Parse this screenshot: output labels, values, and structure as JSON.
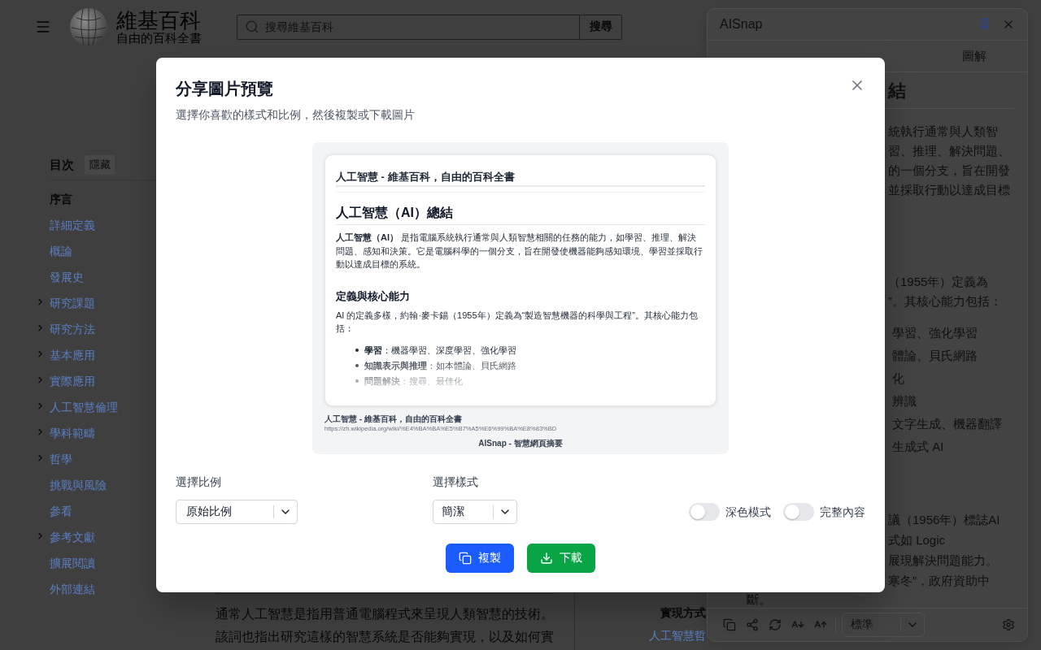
{
  "wiki": {
    "header": {
      "wordmark": "維基百科",
      "tagline": "自由的百科全書",
      "search": {
        "placeholder": "搜尋維基百科",
        "button": "搜尋"
      }
    },
    "toc": {
      "title": "目次",
      "hide_button": "隱藏",
      "items": [
        {
          "label": "序言",
          "selected": true,
          "collapsible": false
        },
        {
          "label": "詳細定義",
          "selected": false,
          "collapsible": false
        },
        {
          "label": "概論",
          "selected": false,
          "collapsible": false
        },
        {
          "label": "發展史",
          "selected": false,
          "collapsible": false
        },
        {
          "label": "研究課題",
          "selected": false,
          "collapsible": true
        },
        {
          "label": "研究方法",
          "selected": false,
          "collapsible": true
        },
        {
          "label": "基本應用",
          "selected": false,
          "collapsible": true
        },
        {
          "label": "實際應用",
          "selected": false,
          "collapsible": true
        },
        {
          "label": "人工智慧倫理",
          "selected": false,
          "collapsible": true
        },
        {
          "label": "學科範疇",
          "selected": false,
          "collapsible": true
        },
        {
          "label": "哲學",
          "selected": false,
          "collapsible": true
        },
        {
          "label": "挑戰與風險",
          "selected": false,
          "collapsible": false
        },
        {
          "label": "參看",
          "selected": false,
          "collapsible": false
        },
        {
          "label": "參考文獻",
          "selected": false,
          "collapsible": true
        },
        {
          "label": "擴展閱讀",
          "selected": false,
          "collapsible": false
        },
        {
          "label": "外部連結",
          "selected": false,
          "collapsible": false
        }
      ]
    },
    "article": {
      "lines": [
        "通常人工智慧是指用普通電腦程式來呈現人類智慧的技術。",
        "該詞也指出研究這樣的智慧系統是否能夠實現，以及如何實"
      ]
    },
    "infobox": {
      "items": [
        {
          "kind": "label",
          "text": "實現方式"
        },
        {
          "kind": "link",
          "text": "人工智慧哲"
        }
      ]
    }
  },
  "side_panel": {
    "title": "AISnap",
    "tabs": [
      {
        "label": "圖解"
      }
    ],
    "summary": {
      "heading": "結",
      "blocks": [
        {
          "kind": "text",
          "lines": [
            "統執行通常與人類智",
            "習、推理、解決問題、",
            "的一個分支，旨在開發",
            "並採取行動以達成目標"
          ]
        },
        {
          "kind": "text",
          "lines": [
            "（1955年）定義為",
            "”。其核心能力包括："
          ]
        },
        {
          "kind": "list",
          "lines": [
            "學習、強化學習",
            "體論、貝氏網路",
            "化",
            "辨識",
            "文字生成、機器翻譯",
            "生成式 AI"
          ]
        },
        {
          "kind": "text",
          "lines": [
            "議（1956年）標誌AI",
            "式如 Logic",
            "展現解決問題能力。",
            "寒冬”，政府資助中"
          ]
        }
      ],
      "tail": "斷。"
    },
    "toolbar": {
      "size_select": "標準"
    }
  },
  "share_dialog": {
    "title": "分享圖片預覽",
    "subtitle": "選擇你喜歡的樣式和比例，然後複製或下載圖片",
    "preview": {
      "page_title": "人工智慧 - 維基百科，自由的百科全書",
      "heading": "人工智慧（AI）總結",
      "intro": "**人工智慧（AI）** 是指電腦系統執行通常與人類智慧相關的任務的能力，如學習、推理、解決問題、感知和決策。它是電腦科學的一個分支，旨在開發使機器能夠感知環境、學習並採取行動以達成目標的系統。",
      "section_heading": "定義與核心能力",
      "section_text": "AI 的定義多樣，約翰·麥卡錫（1955年）定義為“製造智慧機器的科學與工程”。其核心能力包括：",
      "list": [
        "**學習**：機器學習、深度學習、強化學習",
        "**知識表示與推理**：如本體論、貝氏網路",
        "**問題解決**：搜尋、最佳化"
      ],
      "footer_title": "人工智慧 - 維基百科，自由的百科全書",
      "url": "https://zh.wikipedia.org/wiki/%E4%BA%BA%E5%B7%A5%E6%99%BA%E8%83%BD",
      "brand": "AISnap - 智慧網頁摘要"
    },
    "ratio": {
      "label": "選擇比例",
      "value": "原始比例"
    },
    "style": {
      "label": "選擇樣式",
      "value": "簡潔"
    },
    "toggles": [
      {
        "label": "深色模式",
        "on": false
      },
      {
        "label": "完整內容",
        "on": false
      }
    ],
    "buttons": [
      {
        "kind": "copy",
        "label": "複製"
      },
      {
        "kind": "download",
        "label": "下載"
      }
    ]
  }
}
